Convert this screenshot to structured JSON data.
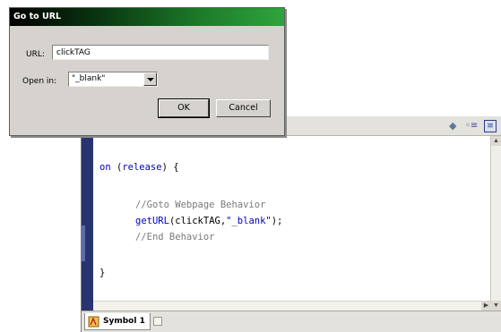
{
  "dialog": {
    "title": "Go to URL",
    "url_label": "URL:",
    "url_value": "clickTAG",
    "open_label": "Open in:",
    "open_value": "\"_blank\"",
    "ok_label": "OK",
    "cancel_label": "Cancel",
    "title_color": "#1d7c2a"
  },
  "editor": {
    "code": {
      "line1_kw": "on",
      "line1_rest": " (",
      "line1_event": "release",
      "line1_end": ") {",
      "line2": "//Goto Webpage Behavior",
      "line3_fn": "getURL",
      "line3_args": "(clickTAG,",
      "line3_str": "\"_blank\"",
      "line3_end": ");",
      "line4": "//End Behavior",
      "line5": "}"
    },
    "gutter_color": "#27346f",
    "tab": {
      "label": "Symbol 1"
    }
  }
}
